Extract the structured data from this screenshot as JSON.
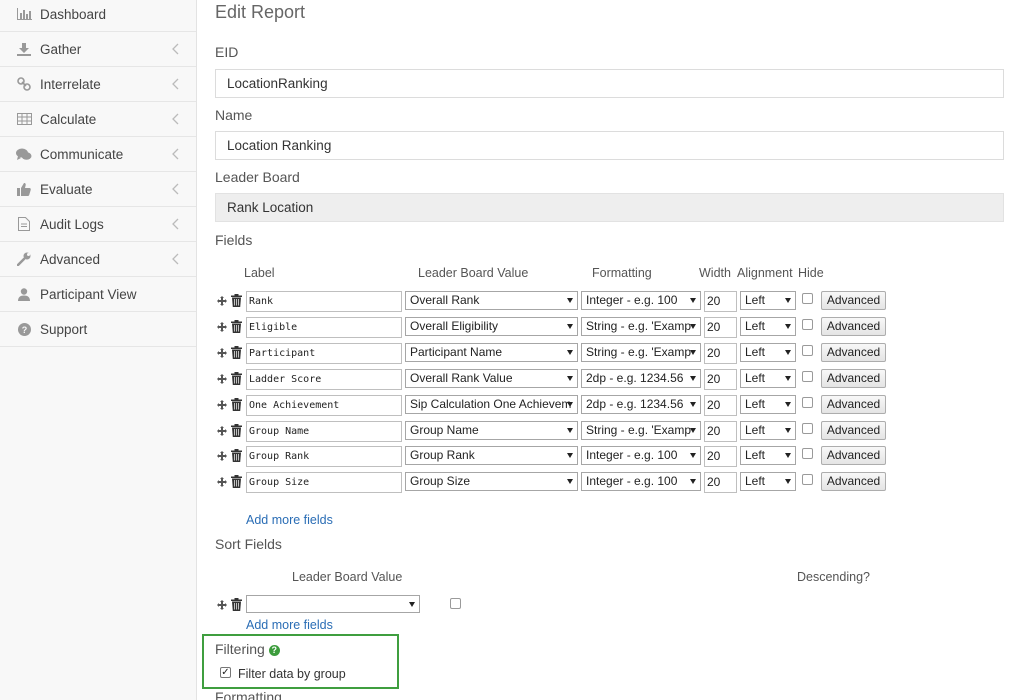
{
  "sidebar": {
    "items": [
      {
        "label": "Dashboard",
        "icon": "bar-chart-icon",
        "chevron": false
      },
      {
        "label": "Gather",
        "icon": "download-icon",
        "chevron": true
      },
      {
        "label": "Interrelate",
        "icon": "link-icon",
        "chevron": true
      },
      {
        "label": "Calculate",
        "icon": "table-icon",
        "chevron": true
      },
      {
        "label": "Communicate",
        "icon": "comments-icon",
        "chevron": true
      },
      {
        "label": "Evaluate",
        "icon": "thumbs-up-icon",
        "chevron": true
      },
      {
        "label": "Audit Logs",
        "icon": "file-icon",
        "chevron": true
      },
      {
        "label": "Advanced",
        "icon": "wrench-icon",
        "chevron": true
      },
      {
        "label": "Participant View",
        "icon": "user-icon",
        "chevron": false
      },
      {
        "label": "Support",
        "icon": "question-icon",
        "chevron": false
      }
    ]
  },
  "page": {
    "title": "Edit Report",
    "eid_label": "EID",
    "eid_value": "LocationRanking",
    "name_label": "Name",
    "name_value": "Location Ranking",
    "leaderboard_label": "Leader Board",
    "leaderboard_value": "Rank Location",
    "fields_label": "Fields"
  },
  "fields_table": {
    "headers": {
      "label": "Label",
      "leader_board_value": "Leader Board Value",
      "formatting": "Formatting",
      "width": "Width",
      "alignment": "Alignment",
      "hide": "Hide"
    },
    "advanced_label": "Advanced",
    "rows": [
      {
        "label": "Rank",
        "value": "Overall Rank",
        "format": "Integer - e.g. 100",
        "width": "20",
        "align": "Left"
      },
      {
        "label": "Eligible",
        "value": "Overall Eligibility",
        "format": "String - e.g. 'Examp",
        "width": "20",
        "align": "Left"
      },
      {
        "label": "Participant",
        "value": "Participant Name",
        "format": "String - e.g. 'Examp",
        "width": "20",
        "align": "Left"
      },
      {
        "label": "Ladder Score",
        "value": "Overall Rank Value",
        "format": "2dp - e.g. 1234.56",
        "width": "20",
        "align": "Left"
      },
      {
        "label": "One Achievement",
        "value": "Sip Calculation One Achievem",
        "format": "2dp - e.g. 1234.56",
        "width": "20",
        "align": "Left"
      },
      {
        "label": "Group Name",
        "value": "Group Name",
        "format": "String - e.g. 'Examp",
        "width": "20",
        "align": "Left"
      },
      {
        "label": "Group Rank",
        "value": "Group Rank",
        "format": "Integer - e.g. 100",
        "width": "20",
        "align": "Left"
      },
      {
        "label": "Group Size",
        "value": "Group Size",
        "format": "Integer - e.g. 100",
        "width": "20",
        "align": "Left"
      }
    ],
    "add_more": "Add more fields"
  },
  "sort_fields": {
    "label": "Sort Fields",
    "header_value": "Leader Board Value",
    "header_desc": "Descending?",
    "row_value": "",
    "add_more": "Add more fields"
  },
  "filtering": {
    "label": "Filtering",
    "help": "?",
    "checkbox_label": "Filter data by group",
    "checked": true
  },
  "next_section": {
    "label": "Formatting"
  },
  "colors": {
    "accent_link": "#2a6db5",
    "highlight_box": "#3f9e3f",
    "help_icon": "#3c9c3c"
  }
}
